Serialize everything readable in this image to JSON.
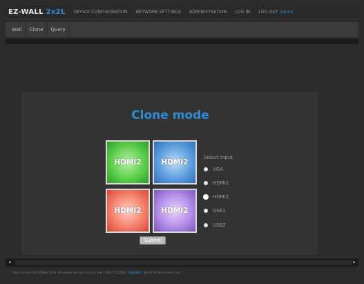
{
  "nav": {
    "brand_main": "EZ-WALL",
    "brand_accent": "2x2L",
    "items": [
      "DEVICE CONFIGURATION",
      "NETWORK SETTINGS",
      "ADMINISTRATION",
      "LOG IN"
    ],
    "logout_label": "LOG OUT",
    "logout_user": "admin"
  },
  "subnav": {
    "tabs": [
      "Wall",
      "Clone",
      "Query"
    ]
  },
  "panel": {
    "title": "Clone mode",
    "tiles": [
      "HDMI2",
      "HDMI2",
      "HDMI2",
      "HDMI2"
    ],
    "select_label": "Select Input",
    "options": [
      "VGA",
      "HDMI1",
      "HDMI2",
      "USB1",
      "USB2"
    ],
    "selected": "HDMI2",
    "submit_label": "Submit"
  },
  "footer": {
    "text_left": "Web Control for EZWall 2x2L   Firmware Version V1.0.0 Feb 1 2017   ©2016",
    "link": "DigitaBit",
    "text_right": "World Wide Limited, Inc."
  },
  "colors": {
    "accent": "#2f8ed6",
    "green_tile": "#5fd04d",
    "blue_tile": "#5f9fe0",
    "red_tile": "#f4826c",
    "purple_tile": "#b58ee8"
  }
}
